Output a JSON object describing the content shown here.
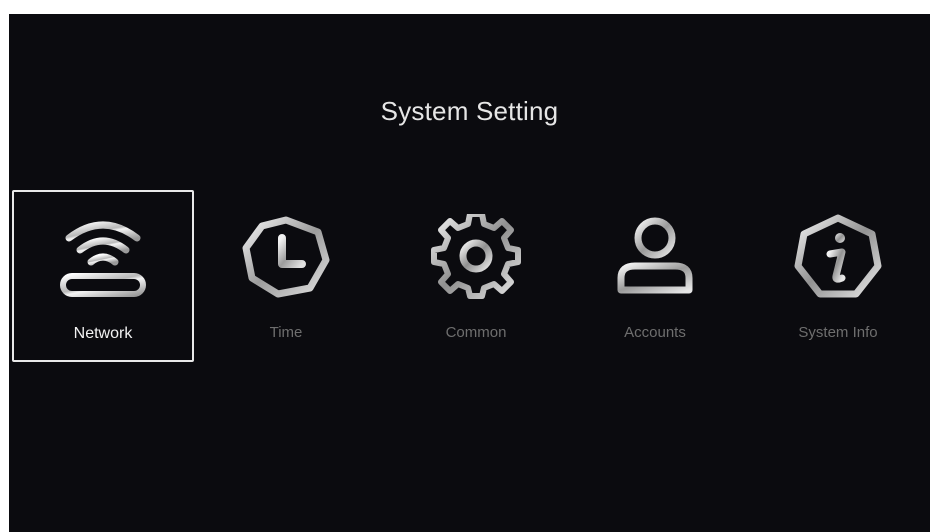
{
  "screen": {
    "title": "System Setting"
  },
  "menu": {
    "selected_index": 0,
    "items": [
      {
        "label": "Network",
        "icon": "wifi-router-icon"
      },
      {
        "label": "Time",
        "icon": "clock-icon"
      },
      {
        "label": "Common",
        "icon": "gear-icon"
      },
      {
        "label": "Accounts",
        "icon": "user-icon"
      },
      {
        "label": "System Info",
        "icon": "info-icon"
      }
    ]
  },
  "colors": {
    "background": "#0b0b0f",
    "selected_border": "#e9e9e9",
    "selected_text": "#f2f2f2",
    "unselected_text": "#6e6e6e"
  }
}
